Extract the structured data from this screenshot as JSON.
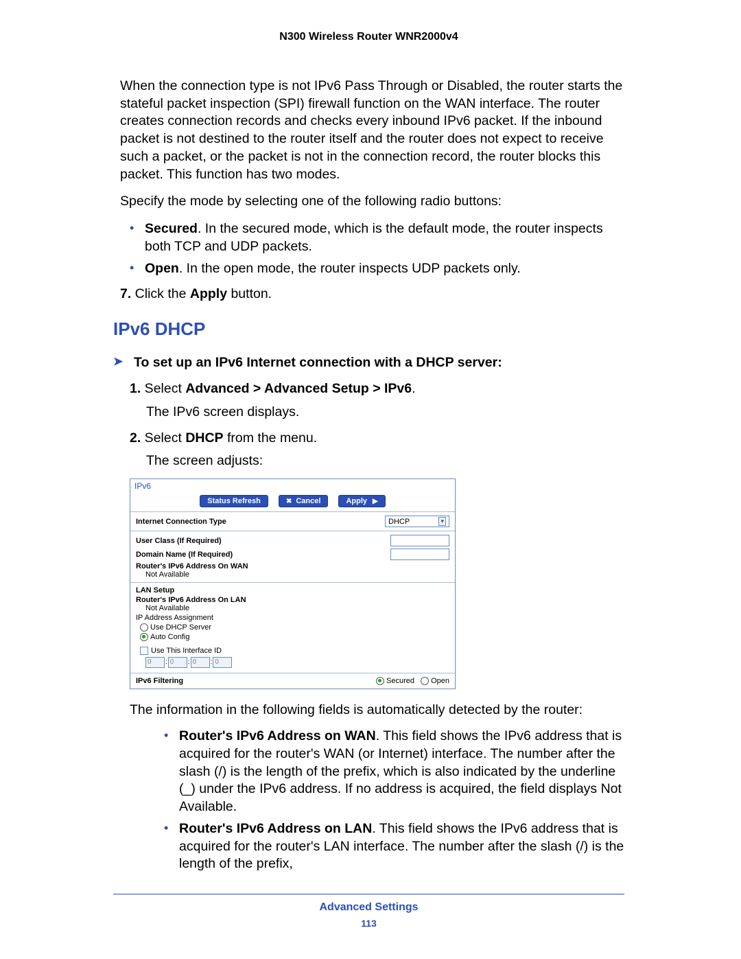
{
  "header": {
    "title": "N300 Wireless Router WNR2000v4"
  },
  "intro": {
    "p1": "When the connection type is not IPv6 Pass Through or Disabled, the router starts the stateful packet inspection (SPI) firewall function on the WAN interface. The router creates connection records and checks every inbound IPv6 packet. If the inbound packet is not destined to the router itself and the router does not expect to receive such a packet, or the packet is not in the connection record, the router blocks this packet. This function has two modes.",
    "p2": "Specify the mode by selecting one of the following radio buttons:"
  },
  "modes": {
    "secured_b": "Secured",
    "secured_t": ". In the secured mode, which is the default mode, the router inspects both TCP and UDP packets.",
    "open_b": "Open",
    "open_t": ". In the open mode, the router inspects UDP packets only."
  },
  "step7": {
    "num": "7.",
    "pre": " Click the ",
    "b": "Apply",
    "post": " button."
  },
  "heading": "IPv6 DHCP",
  "task": "To set up an IPv6 Internet connection with a DHCP server:",
  "s1": {
    "num": "1.",
    "pre": " Select ",
    "b": "Advanced > Advanced Setup > IPv6",
    "post": ".",
    "sub": "The IPv6 screen displays."
  },
  "s2": {
    "num": "2.",
    "pre": " Select ",
    "b": "DHCP",
    "post": " from the menu.",
    "sub": "The screen adjusts:"
  },
  "shot": {
    "title": "IPv6",
    "btn_refresh": "Status Refresh",
    "btn_cancel": "Cancel",
    "btn_apply": "Apply",
    "ict_label": "Internet Connection Type",
    "ict_value": "DHCP",
    "user_class": "User Class (If Required)",
    "domain_name": "Domain Name  (If Required)",
    "wan_addr_label": "Router's IPv6 Address On WAN",
    "not_avail": "Not Available",
    "lan_setup": "LAN Setup",
    "lan_addr_label": "Router's IPv6 Address On LAN",
    "ip_assign": "IP Address Assignment",
    "use_dhcp": "Use DHCP Server",
    "auto_cfg": "Auto Config",
    "use_iface": "Use This Interface ID",
    "id0": "0",
    "id1": "0",
    "id2": "0",
    "id3": "0",
    "filtering": "IPv6 Filtering",
    "secured": "Secured",
    "open": "Open"
  },
  "after": "The information in the following fields is automatically detected by the router:",
  "b1": {
    "b": "Router's IPv6 Address on WAN",
    "t": ". This field shows the IPv6 address that is acquired for the router's WAN (or Internet) interface. The number after the slash (/) is the length of the prefix, which is also indicated by the underline (_) under the IPv6 address. If no address is acquired, the field displays Not Available."
  },
  "b2": {
    "b": "Router's IPv6 Address on LAN",
    "t": ". This field shows the IPv6 address that is acquired for the router's LAN interface. The number after the slash (/) is the length of the prefix,"
  },
  "footer": {
    "section": "Advanced Settings",
    "page": "113"
  }
}
